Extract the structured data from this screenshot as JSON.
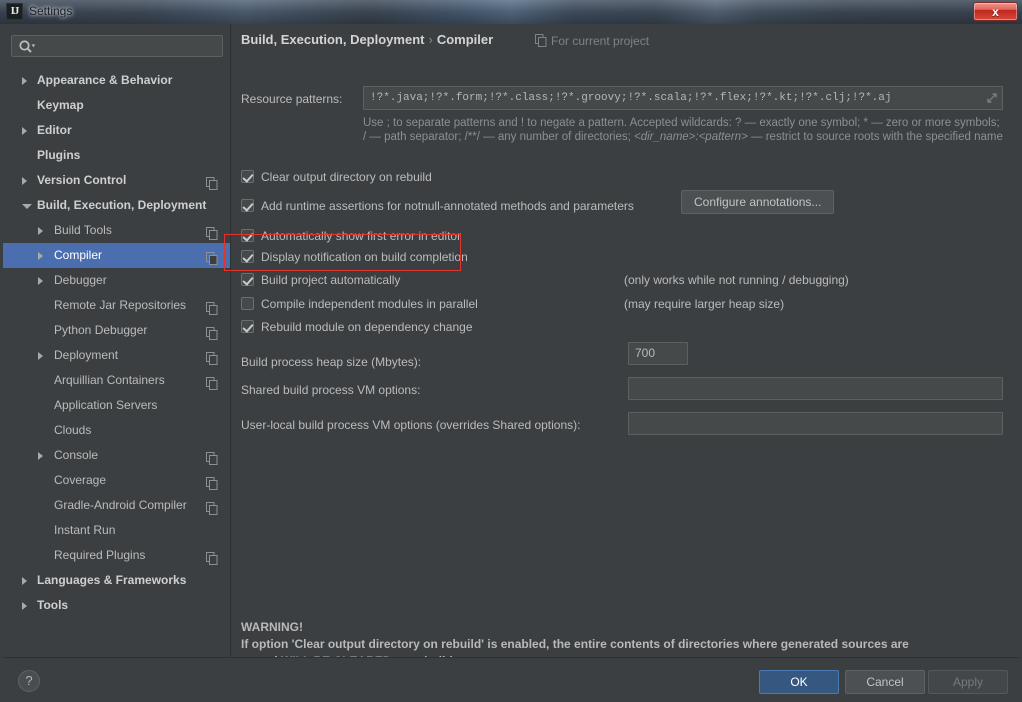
{
  "window": {
    "title": "Settings",
    "app_icon_text": "IJ",
    "close_label": "x"
  },
  "sidebar": {
    "search": {
      "value": "",
      "placeholder": "",
      "icon": "search-icon"
    },
    "items": [
      {
        "label": "Appearance & Behavior",
        "level": 0,
        "arrow": "collapsed",
        "copy_icon": false,
        "selected": false
      },
      {
        "label": "Keymap",
        "level": 0,
        "arrow": "none",
        "copy_icon": false,
        "selected": false
      },
      {
        "label": "Editor",
        "level": 0,
        "arrow": "collapsed",
        "copy_icon": false,
        "selected": false
      },
      {
        "label": "Plugins",
        "level": 0,
        "arrow": "none",
        "copy_icon": false,
        "selected": false
      },
      {
        "label": "Version Control",
        "level": 0,
        "arrow": "collapsed",
        "copy_icon": true,
        "selected": false
      },
      {
        "label": "Build, Execution, Deployment",
        "level": 0,
        "arrow": "expanded",
        "copy_icon": false,
        "selected": false
      },
      {
        "label": "Build Tools",
        "level": 1,
        "arrow": "collapsed",
        "copy_icon": true,
        "selected": false
      },
      {
        "label": "Compiler",
        "level": 1,
        "arrow": "collapsed",
        "copy_icon": true,
        "selected": true
      },
      {
        "label": "Debugger",
        "level": 1,
        "arrow": "collapsed",
        "copy_icon": false,
        "selected": false
      },
      {
        "label": "Remote Jar Repositories",
        "level": 1,
        "arrow": "none",
        "copy_icon": true,
        "selected": false
      },
      {
        "label": "Python Debugger",
        "level": 1,
        "arrow": "none",
        "copy_icon": true,
        "selected": false
      },
      {
        "label": "Deployment",
        "level": 1,
        "arrow": "collapsed",
        "copy_icon": true,
        "selected": false
      },
      {
        "label": "Arquillian Containers",
        "level": 1,
        "arrow": "none",
        "copy_icon": true,
        "selected": false
      },
      {
        "label": "Application Servers",
        "level": 1,
        "arrow": "none",
        "copy_icon": false,
        "selected": false
      },
      {
        "label": "Clouds",
        "level": 1,
        "arrow": "none",
        "copy_icon": false,
        "selected": false
      },
      {
        "label": "Console",
        "level": 1,
        "arrow": "collapsed",
        "copy_icon": true,
        "selected": false
      },
      {
        "label": "Coverage",
        "level": 1,
        "arrow": "none",
        "copy_icon": true,
        "selected": false
      },
      {
        "label": "Gradle-Android Compiler",
        "level": 1,
        "arrow": "none",
        "copy_icon": true,
        "selected": false
      },
      {
        "label": "Instant Run",
        "level": 1,
        "arrow": "none",
        "copy_icon": false,
        "selected": false
      },
      {
        "label": "Required Plugins",
        "level": 1,
        "arrow": "none",
        "copy_icon": true,
        "selected": false
      },
      {
        "label": "Languages & Frameworks",
        "level": 0,
        "arrow": "collapsed",
        "copy_icon": false,
        "selected": false
      },
      {
        "label": "Tools",
        "level": 0,
        "arrow": "collapsed",
        "copy_icon": false,
        "selected": false
      }
    ]
  },
  "content": {
    "breadcrumb_root": "Build, Execution, Deployment",
    "breadcrumb_separator": "›",
    "breadcrumb_leaf": "Compiler",
    "project_scope": "For current project",
    "resource_patterns": {
      "label": "Resource patterns:",
      "value": "!?*.java;!?*.form;!?*.class;!?*.groovy;!?*.scala;!?*.flex;!?*.kt;!?*.clj;!?*.aj",
      "hint": "Use ; to separate patterns and ! to negate a pattern. Accepted wildcards: ? — exactly one symbol; * — zero or more symbols; / — path separator; /**/ — any number of directories; <dir_name>:<pattern> — restrict to source roots with the specified name",
      "expand_icon": "expand-icon"
    },
    "options": [
      {
        "label": "Clear output directory on rebuild",
        "checked": true,
        "note": ""
      },
      {
        "label": "Add runtime assertions for notnull-annotated methods and parameters",
        "checked": true,
        "note": ""
      },
      {
        "label": "Automatically show first error in editor",
        "checked": true,
        "note": ""
      },
      {
        "label": "Display notification on build completion",
        "checked": true,
        "note": ""
      },
      {
        "label": "Build project automatically",
        "checked": true,
        "note": "(only works while not running / debugging)"
      },
      {
        "label": "Compile independent modules in parallel",
        "checked": false,
        "note": "(may require larger heap size)"
      },
      {
        "label": "Rebuild module on dependency change",
        "checked": true,
        "note": ""
      }
    ],
    "configure_annotations_label": "Configure annotations...",
    "fields": [
      {
        "label": "Build process heap size (Mbytes):",
        "value": "700"
      },
      {
        "label": "Shared build process VM options:",
        "value": ""
      },
      {
        "label": "User-local build process VM options (overrides Shared options):",
        "value": ""
      }
    ],
    "warning": {
      "title": "WARNING!",
      "line1": "If option 'Clear output directory on rebuild' is enabled, the entire contents of directories where generated sources are",
      "line2": "stored WILL BE CLEARED on rebuild."
    }
  },
  "footer": {
    "help_label": "?",
    "ok_label": "OK",
    "cancel_label": "Cancel",
    "apply_label": "Apply"
  },
  "annotation": {
    "color": "#e2342a"
  }
}
